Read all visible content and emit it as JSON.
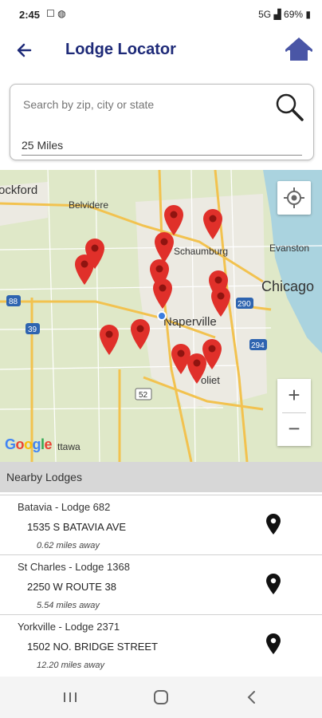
{
  "status_bar": {
    "time": "2:45",
    "network": "5G",
    "battery": "69%"
  },
  "header": {
    "title": "Lodge Locator"
  },
  "search": {
    "placeholder": "Search by zip, city or state",
    "radius": "25 Miles"
  },
  "map": {
    "labels": {
      "rockford": "ockford",
      "belvidere": "Belvidere",
      "schaumburg": "Schaumburg",
      "evanston": "Evanston",
      "chicago": "Chicago",
      "naperville": "Naperville",
      "joliet": "oliet",
      "ottawa": "ttawa",
      "route_88": "88",
      "route_39": "39",
      "route_52": "52",
      "route_290": "290",
      "route_294": "294",
      "google": "Google"
    },
    "colors": {
      "marker": "#e0302a",
      "land": "#dfe8c8",
      "urban": "#eceae2",
      "water": "#aad3df",
      "road_major": "#f2c24f",
      "road_minor": "#ffffff"
    }
  },
  "list": {
    "header": "Nearby Lodges",
    "lodges": [
      {
        "name": "Batavia - Lodge 682",
        "address": "1535 S BATAVIA AVE",
        "distance": "0.62 miles away"
      },
      {
        "name": "St Charles - Lodge 1368",
        "address": "2250 W ROUTE 38",
        "distance": "5.54 miles away"
      },
      {
        "name": "Yorkville - Lodge 2371",
        "address": "1502  NO.  BRIDGE STREET",
        "distance": "12.20 miles away"
      }
    ]
  },
  "colors": {
    "accent": "#1e2a78",
    "home_icon": "#4a56a6"
  }
}
